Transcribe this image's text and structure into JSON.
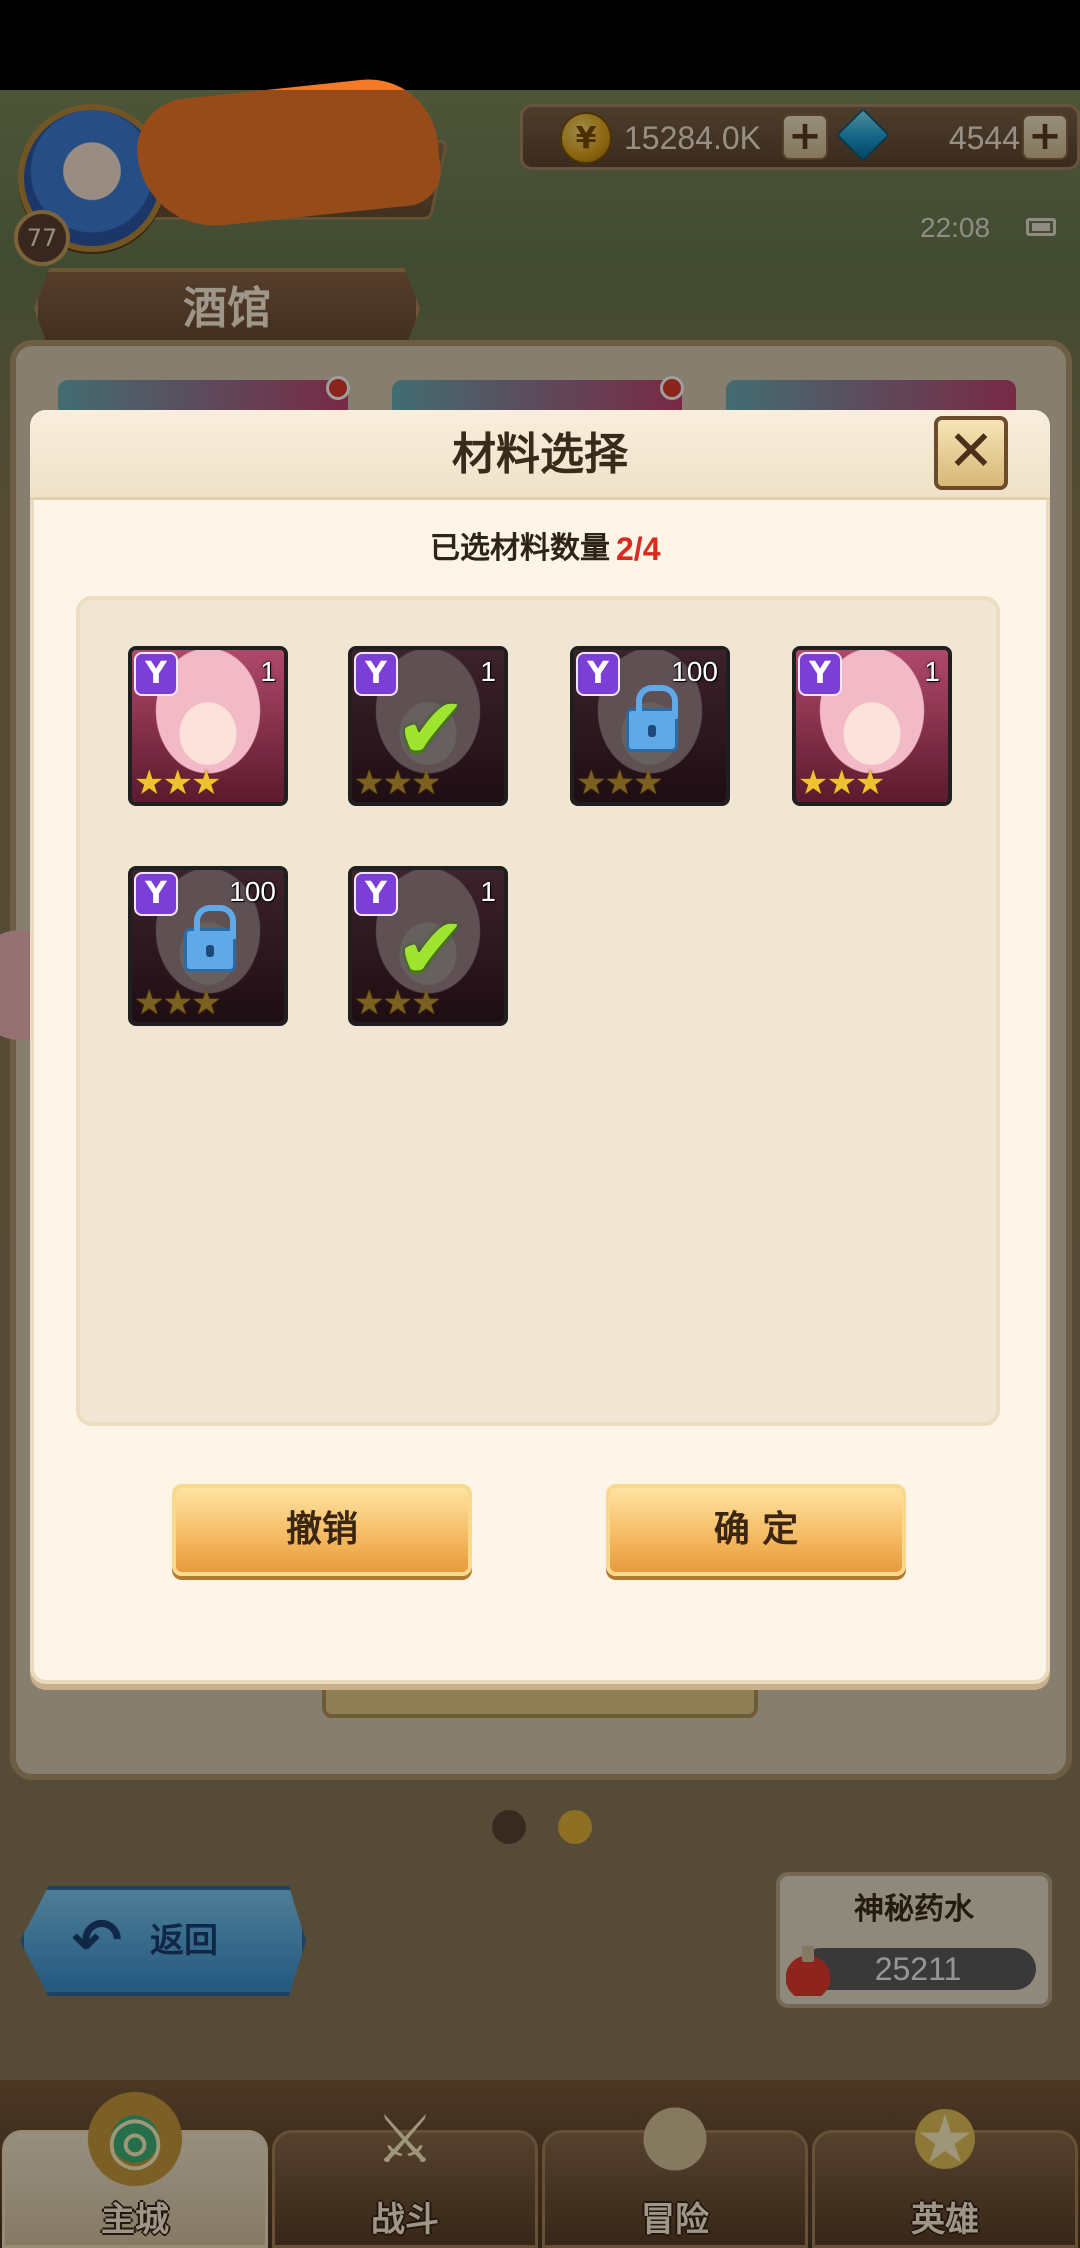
{
  "hud": {
    "level": "77",
    "gold": "15284.0K",
    "gems": "4544",
    "time": "22:08"
  },
  "screen": {
    "title": "酒馆"
  },
  "dialog": {
    "title": "材料选择",
    "selected_label": "已选材料数量",
    "selected_count": "2/4",
    "cancel_label": "撤销",
    "confirm_label": "确 定"
  },
  "materials": [
    {
      "qty": "1",
      "stars": "★★★",
      "state": "available"
    },
    {
      "qty": "1",
      "stars": "★★★",
      "state": "selected"
    },
    {
      "qty": "100",
      "stars": "★★★",
      "state": "locked"
    },
    {
      "qty": "1",
      "stars": "★★★",
      "state": "available"
    },
    {
      "qty": "100",
      "stars": "★★★",
      "state": "locked"
    },
    {
      "qty": "1",
      "stars": "★★★",
      "state": "selected"
    }
  ],
  "footer": {
    "back_label": "返回",
    "potion_title": "神秘药水",
    "potion_value": "25211"
  },
  "nav": [
    {
      "label": "主城",
      "icon": "main-city-icon",
      "active": true
    },
    {
      "label": "战斗",
      "icon": "crossed-swords-icon",
      "active": false
    },
    {
      "label": "冒险",
      "icon": "adventure-map-icon",
      "active": false
    },
    {
      "label": "英雄",
      "icon": "hero-emblem-icon",
      "active": false
    }
  ],
  "colors": {
    "accent_red": "#d92a1e",
    "button_orange": "#f4b960",
    "faction_purple": "#7b3ed6",
    "check_green": "#9fe530"
  }
}
